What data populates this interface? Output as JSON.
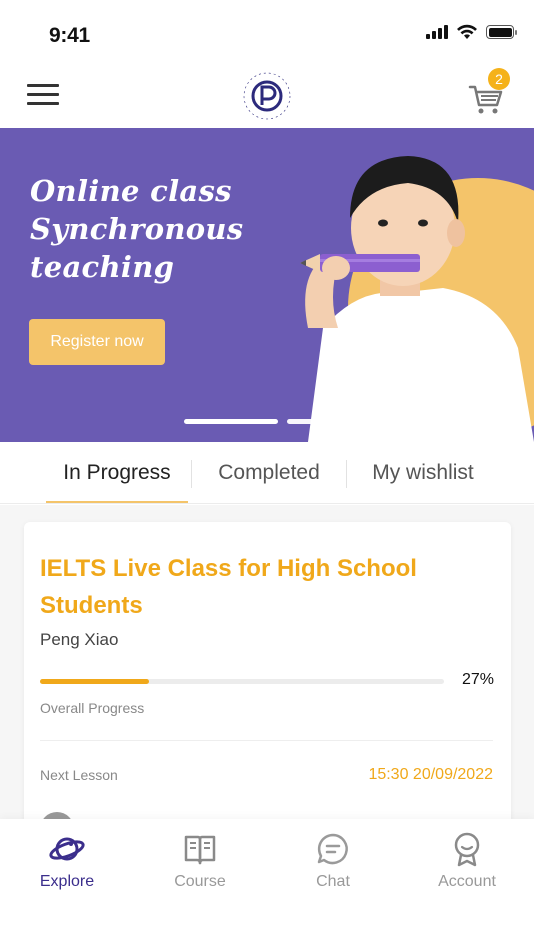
{
  "status": {
    "time": "9:41"
  },
  "header": {
    "cart_count": "2"
  },
  "banner": {
    "title_lines": [
      "Online class",
      "Synchronous",
      "teaching"
    ],
    "cta_label": "Register now",
    "slides": 3,
    "active_slide": 1
  },
  "tabs": [
    {
      "label": "In Progress",
      "active": true
    },
    {
      "label": "Completed",
      "active": false
    },
    {
      "label": "My wishlist",
      "active": false
    }
  ],
  "course": {
    "title": "IELTS Live Class for High School Students",
    "teacher": "Peng Xiao",
    "progress_percent": 27,
    "progress_label": "27%",
    "progress_caption": "Overall Progress",
    "next_lesson_label": "Next Lesson",
    "next_lesson_time": "15:30 20/09/2022"
  },
  "bottom_nav": [
    {
      "label": "Explore",
      "icon": "planet-icon",
      "active": true
    },
    {
      "label": "Course",
      "icon": "book-icon",
      "active": false
    },
    {
      "label": "Chat",
      "icon": "chat-bubble-icon",
      "active": false
    },
    {
      "label": "Account",
      "icon": "user-icon",
      "active": false
    }
  ],
  "colors": {
    "brand_purple": "#6a5bb3",
    "accent_orange": "#f0a81a",
    "button_yellow": "#f4c46a",
    "nav_active": "#3b2e8c"
  }
}
